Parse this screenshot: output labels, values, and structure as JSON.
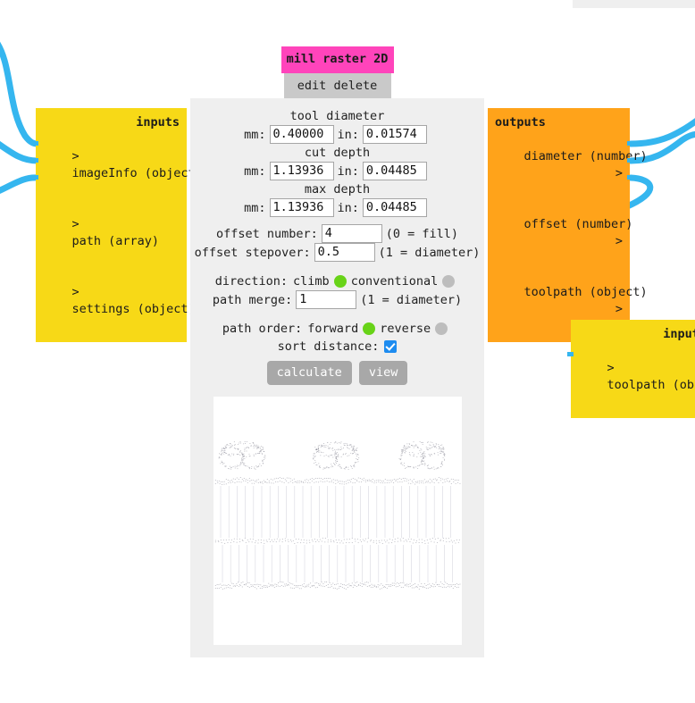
{
  "theme": {
    "title_bar_color": "#ff44bb",
    "action_bar_color": "#c9c9c9",
    "panel_color": "#efefef",
    "inputs_node_color": "#f7d917",
    "outputs_node_color": "#ffa31a",
    "wire_color": "#35b6ef",
    "radio_on_color": "#68d318",
    "radio_off_color": "#bdbdbd",
    "checkbox_color": "#1d8cf0",
    "button_color": "#a8a8a8"
  },
  "node": {
    "title": "mill raster 2D",
    "edit_label": "edit",
    "delete_label": "delete",
    "actions_label": "edit delete"
  },
  "inputs_node": {
    "heading": "inputs",
    "ports": [
      {
        "arrow": ">",
        "label": "imageInfo (object)"
      },
      {
        "arrow": ">",
        "label": "path (array)"
      },
      {
        "arrow": ">",
        "label": "settings (object)"
      }
    ]
  },
  "outputs_node": {
    "heading": "outputs",
    "ports": [
      {
        "label": "diameter (number)",
        "arrow": ">"
      },
      {
        "label": "offset (number)",
        "arrow": ">"
      },
      {
        "label": "toolpath (object)",
        "arrow": ">"
      }
    ]
  },
  "inputs_node_2": {
    "heading": "inputs",
    "ports": [
      {
        "arrow": ">",
        "label": "toolpath (object)"
      }
    ]
  },
  "form": {
    "tool_diameter": {
      "caption": "tool diameter",
      "mm_label": "mm:",
      "mm_value": "0.40000",
      "in_label": "in:",
      "in_value": "0.01574"
    },
    "cut_depth": {
      "caption": "cut depth",
      "mm_label": "mm:",
      "mm_value": "1.13936",
      "in_label": "in:",
      "in_value": "0.04485"
    },
    "max_depth": {
      "caption": "max depth",
      "mm_label": "mm:",
      "mm_value": "1.13936",
      "in_label": "in:",
      "in_value": "0.04485"
    },
    "offset_number": {
      "label": "offset number:",
      "value": "4",
      "hint": "(0 = fill)"
    },
    "offset_stepover": {
      "label": "offset stepover:",
      "value": "0.5",
      "hint": "(1 = diameter)"
    },
    "direction": {
      "label": "direction:",
      "option_a": "climb",
      "option_b": "conventional",
      "selected": "climb"
    },
    "path_merge": {
      "label": "path merge:",
      "value": "1",
      "hint": "(1 = diameter)"
    },
    "path_order": {
      "label": "path order:",
      "option_a": "forward",
      "option_b": "reverse",
      "selected": "forward"
    },
    "sort_distance": {
      "label": "sort distance:",
      "checked": true
    },
    "buttons": {
      "calculate": "calculate",
      "view": "view"
    }
  }
}
